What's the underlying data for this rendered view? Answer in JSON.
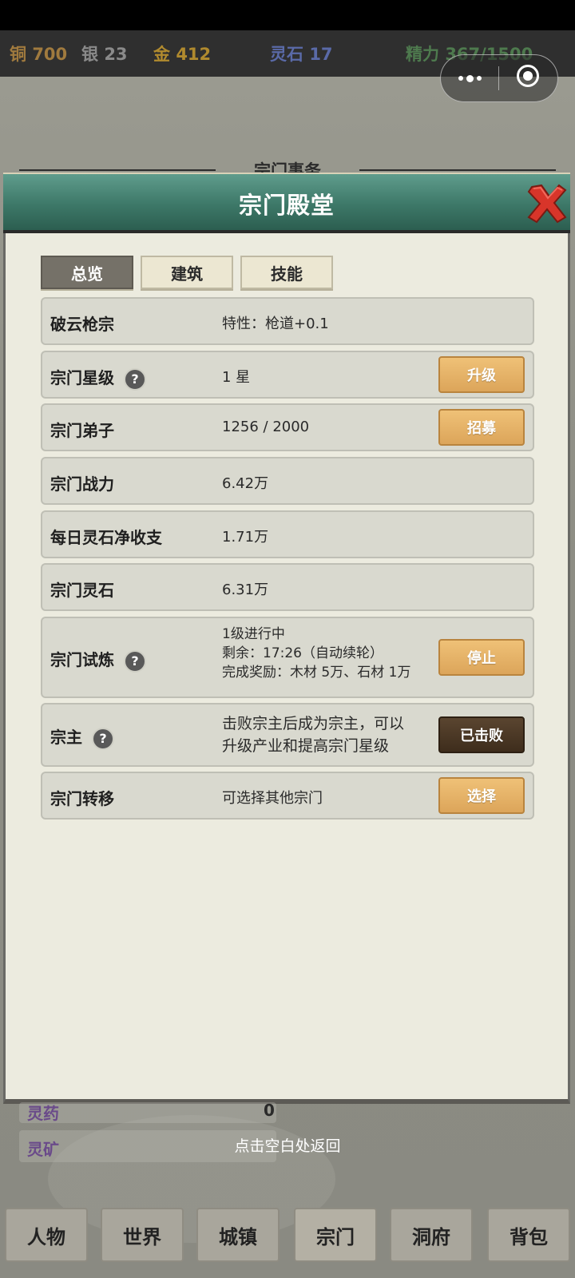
{
  "resources": [
    {
      "name": "铜",
      "value": "700",
      "color": "#a07a3e"
    },
    {
      "name": "银",
      "value": "23",
      "color": "#8a8a8a"
    },
    {
      "name": "金",
      "value": "412",
      "color": "#b08a2e"
    },
    {
      "name": "灵石",
      "value": "17",
      "color": "#5a6aa8"
    },
    {
      "name": "精力",
      "value": "367/1500",
      "color": "#4e7a4e"
    }
  ],
  "behind_title": "宗门事务",
  "modal": {
    "title": "宗门殿堂",
    "tabs": [
      "总览",
      "建筑",
      "技能"
    ],
    "rows": [
      {
        "label": "破云枪宗",
        "value": "特性：枪道+0.1"
      },
      {
        "label": "宗门星级",
        "value": "1 星",
        "button": "升级"
      },
      {
        "label": "宗门弟子",
        "value": "1256 / 2000",
        "button": "招募"
      },
      {
        "label": "宗门战力",
        "value": "6.42万"
      },
      {
        "label": "每日灵石净收支",
        "value": "1.71万"
      },
      {
        "label": "宗门灵石",
        "value": "6.31万"
      },
      {
        "label": "宗门试炼",
        "value_lines": [
          "1级进行中",
          "剩余：17:26（自动续轮）",
          "完成奖励：木材 5万、石材 1万"
        ],
        "button": "停止"
      },
      {
        "label": "宗主",
        "value_lines": [
          "击败宗主后成为宗主，可以",
          "升级产业和提高宗门星级"
        ],
        "button": "已击败"
      },
      {
        "label": "宗门转移",
        "value": "可选择其他宗门",
        "button": "选择"
      }
    ]
  },
  "under_rows": {
    "row1_label": "灵药",
    "row1_value": "0",
    "row2_label": "灵矿"
  },
  "tap_hint": "点击空白处返回",
  "nav": [
    "人物",
    "世界",
    "城镇",
    "宗门",
    "洞府",
    "背包"
  ]
}
